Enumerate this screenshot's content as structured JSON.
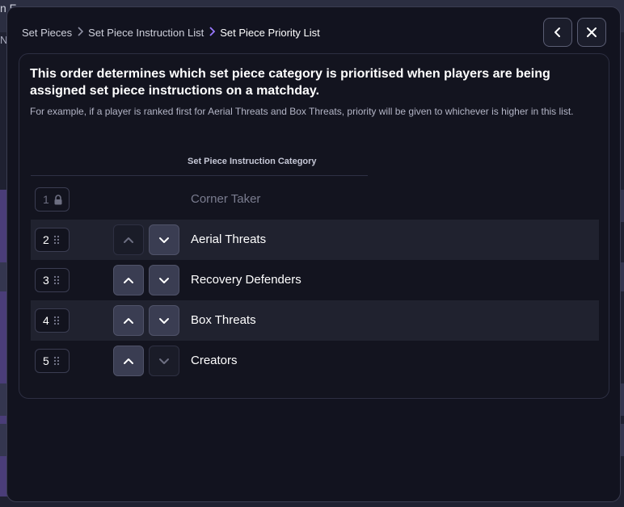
{
  "background": {
    "top_text": "n F",
    "side_text": "N"
  },
  "breadcrumb": {
    "items": [
      "Set Pieces",
      "Set Piece Instruction List",
      "Set Piece Priority List"
    ]
  },
  "header_buttons": {
    "back_icon": "chevron-left-icon",
    "close_icon": "close-icon"
  },
  "panel": {
    "title": "This order determines which set piece category is prioritised when players are being assigned set piece instructions on a matchday.",
    "description": "For example, if a player is ranked first for Aerial Threats and Box Threats, priority will be given to whichever is higher in this list.",
    "column_header": "Set Piece Instruction Category"
  },
  "rows": [
    {
      "rank": "1",
      "label": "Corner Taker",
      "locked": true
    },
    {
      "rank": "2",
      "label": "Aerial Threats",
      "locked": false,
      "up_enabled": false,
      "down_enabled": true
    },
    {
      "rank": "3",
      "label": "Recovery Defenders",
      "locked": false,
      "up_enabled": true,
      "down_enabled": true
    },
    {
      "rank": "4",
      "label": "Box Threats",
      "locked": false,
      "up_enabled": true,
      "down_enabled": true
    },
    {
      "rank": "5",
      "label": "Creators",
      "locked": false,
      "up_enabled": true,
      "down_enabled": false
    }
  ],
  "colors": {
    "accent": "#9a79ff",
    "modal_bg": "#12131f",
    "row_shade": "#20222f",
    "button_bg": "#3a3d52"
  }
}
